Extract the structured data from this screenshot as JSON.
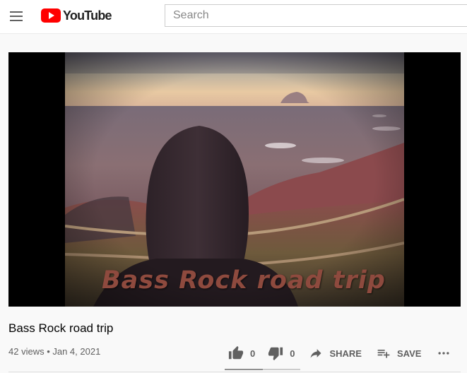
{
  "header": {
    "logo_text": "YouTube",
    "search_placeholder": "Search"
  },
  "player": {
    "overlay_title": "Bass Rock road trip"
  },
  "video": {
    "title": "Bass Rock road trip",
    "views": "42 views",
    "separator": "•",
    "date": "Jan 4, 2021",
    "meta": "42 views • Jan 4, 2021"
  },
  "actions": {
    "likes": "0",
    "dislikes": "0",
    "share_label": "SHARE",
    "save_label": "SAVE"
  },
  "icons": {
    "menu": "menu-icon",
    "logo": "youtube-logo-icon",
    "like": "thumbs-up-icon",
    "dislike": "thumbs-down-icon",
    "share": "share-arrow-icon",
    "save": "playlist-add-icon",
    "more": "more-horizontal-icon"
  },
  "colors": {
    "brand": "#ff0000",
    "secondary_text": "#606060",
    "background": "#f9f9f9"
  },
  "sentiment_fraction": 0.5
}
